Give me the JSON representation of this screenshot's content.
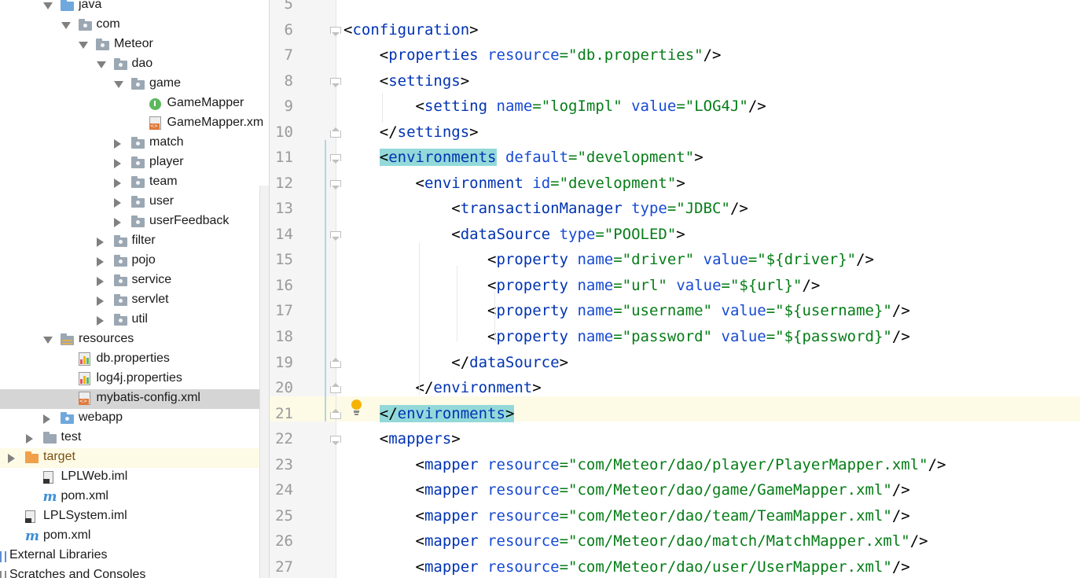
{
  "tree": {
    "items": [
      {
        "label": "java",
        "kind": "src-folder",
        "expanded": true
      },
      {
        "label": "com",
        "kind": "package",
        "expanded": true
      },
      {
        "label": "Meteor",
        "kind": "package",
        "expanded": true
      },
      {
        "label": "dao",
        "kind": "package",
        "expanded": true
      },
      {
        "label": "game",
        "kind": "package",
        "expanded": true
      },
      {
        "label": "GameMapper",
        "kind": "interface"
      },
      {
        "label": "GameMapper.xm",
        "kind": "xml-file"
      },
      {
        "label": "match",
        "kind": "package",
        "expanded": false
      },
      {
        "label": "player",
        "kind": "package",
        "expanded": false
      },
      {
        "label": "team",
        "kind": "package",
        "expanded": false
      },
      {
        "label": "user",
        "kind": "package",
        "expanded": false
      },
      {
        "label": "userFeedback",
        "kind": "package",
        "expanded": false
      },
      {
        "label": "filter",
        "kind": "package",
        "expanded": false
      },
      {
        "label": "pojo",
        "kind": "package",
        "expanded": false
      },
      {
        "label": "service",
        "kind": "package",
        "expanded": false
      },
      {
        "label": "servlet",
        "kind": "package",
        "expanded": false
      },
      {
        "label": "util",
        "kind": "package",
        "expanded": false
      },
      {
        "label": "resources",
        "kind": "resources-folder",
        "expanded": true
      },
      {
        "label": "db.properties",
        "kind": "properties-file"
      },
      {
        "label": "log4j.properties",
        "kind": "properties-file"
      },
      {
        "label": "mybatis-config.xml",
        "kind": "xml-file",
        "selected": true
      },
      {
        "label": "webapp",
        "kind": "web-folder",
        "expanded": false
      },
      {
        "label": "test",
        "kind": "folder",
        "expanded": false
      },
      {
        "label": "target",
        "kind": "excluded-folder",
        "expanded": false
      },
      {
        "label": "LPLWeb.iml",
        "kind": "iml-file"
      },
      {
        "label": "pom.xml",
        "kind": "maven-file"
      },
      {
        "label": "LPLSystem.iml",
        "kind": "iml-file"
      },
      {
        "label": "pom.xml",
        "kind": "maven-file"
      },
      {
        "label": "External Libraries",
        "kind": "libraries",
        "expanded": false
      },
      {
        "label": "Scratches and Consoles",
        "kind": "scratches"
      }
    ]
  },
  "editor": {
    "lines": [
      {
        "n": "5",
        "text": ""
      },
      {
        "n": "6",
        "text": "<configuration>"
      },
      {
        "n": "7",
        "text": "    <properties resource=\"db.properties\"/>"
      },
      {
        "n": "8",
        "text": "    <settings>"
      },
      {
        "n": "9",
        "text": "        <setting name=\"logImpl\" value=\"LOG4J\"/>"
      },
      {
        "n": "10",
        "text": "    </settings>"
      },
      {
        "n": "11",
        "text": "    <environments default=\"development\">"
      },
      {
        "n": "12",
        "text": "        <environment id=\"development\">"
      },
      {
        "n": "13",
        "text": "            <transactionManager type=\"JDBC\"/>"
      },
      {
        "n": "14",
        "text": "            <dataSource type=\"POOLED\">"
      },
      {
        "n": "15",
        "text": "                <property name=\"driver\" value=\"${driver}\"/>"
      },
      {
        "n": "16",
        "text": "                <property name=\"url\" value=\"${url}\"/>"
      },
      {
        "n": "17",
        "text": "                <property name=\"username\" value=\"${username}\"/>"
      },
      {
        "n": "18",
        "text": "                <property name=\"password\" value=\"${password}\"/>"
      },
      {
        "n": "19",
        "text": "            </dataSource>"
      },
      {
        "n": "20",
        "text": "        </environment>"
      },
      {
        "n": "21",
        "text": "    </environments>"
      },
      {
        "n": "22",
        "text": "    <mappers>"
      },
      {
        "n": "23",
        "text": "        <mapper resource=\"com/Meteor/dao/player/PlayerMapper.xml\"/>"
      },
      {
        "n": "24",
        "text": "        <mapper resource=\"com/Meteor/dao/game/GameMapper.xml\"/>"
      },
      {
        "n": "25",
        "text": "        <mapper resource=\"com/Meteor/dao/team/TeamMapper.xml\"/>"
      },
      {
        "n": "26",
        "text": "        <mapper resource=\"com/Meteor/dao/match/MatchMapper.xml\"/>"
      },
      {
        "n": "27",
        "text": "        <mapper resource=\"com/Meteor/dao/user/UserMapper.xml\"/>"
      }
    ],
    "current_line": "21",
    "matched_tag": "environments"
  },
  "colors": {
    "tag": "#0033b3",
    "attribute": "#174ad4",
    "string": "#067d17",
    "tag_match_highlight": "#93d9d9",
    "current_line": "#fdfbe6",
    "selected_tree_row": "#d5d5d5"
  }
}
